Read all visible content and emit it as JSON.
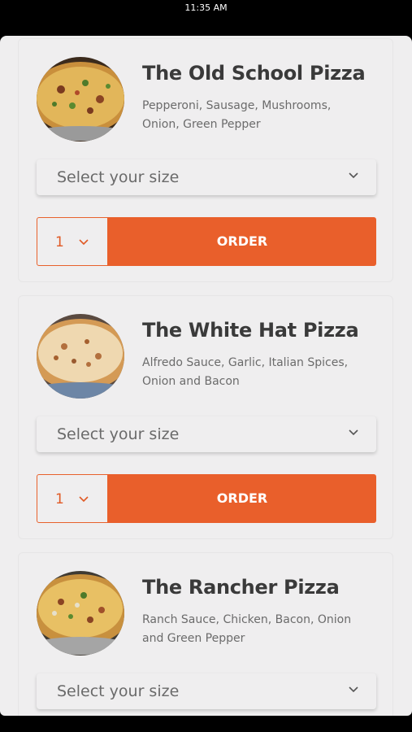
{
  "status_bar": {
    "time": "11:35 AM"
  },
  "menu_items": [
    {
      "name": "The Old School Pizza",
      "description": "Pepperoni, Sausage, Mushrooms, Onion, Green Pepper",
      "size_placeholder": "Select your size",
      "quantity": "1",
      "order_label": "ORDER"
    },
    {
      "name": "The White Hat Pizza",
      "description": "Alfredo Sauce, Garlic, Italian Spices, Onion and Bacon",
      "size_placeholder": "Select your size",
      "quantity": "1",
      "order_label": "ORDER"
    },
    {
      "name": "The Rancher Pizza",
      "description": "Ranch Sauce, Chicken, Bacon, Onion and Green Pepper",
      "size_placeholder": "Select your size",
      "quantity": "",
      "order_label": ""
    }
  ],
  "colors": {
    "accent": "#e95f2b",
    "background": "#efeeef",
    "title": "#3a3a3a"
  },
  "icons": {
    "dropdown": "chevron-down-icon"
  }
}
